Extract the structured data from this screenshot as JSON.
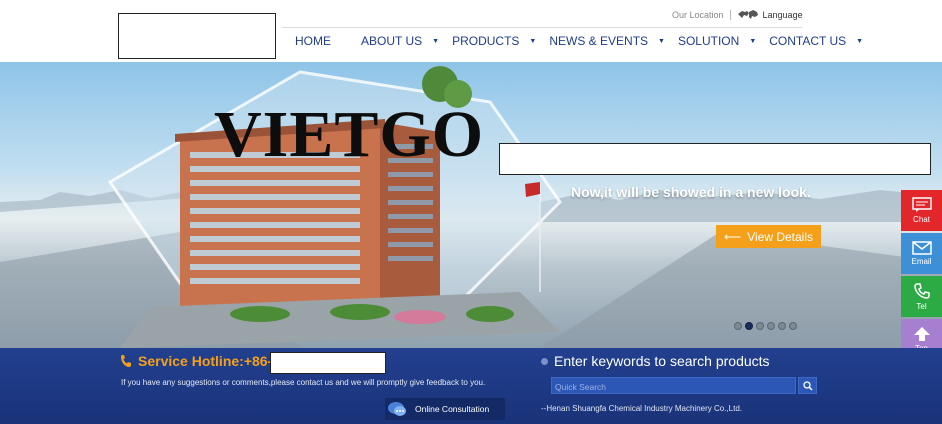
{
  "header": {
    "location_link": "Our Location",
    "language_link": "Language",
    "nav": [
      {
        "label": "HOME",
        "has_dropdown": false
      },
      {
        "label": "ABOUT US",
        "has_dropdown": true
      },
      {
        "label": "PRODUCTS",
        "has_dropdown": true
      },
      {
        "label": "NEWS & EVENTS",
        "has_dropdown": true
      },
      {
        "label": "SOLUTION",
        "has_dropdown": true
      },
      {
        "label": "CONTACT US",
        "has_dropdown": true
      }
    ]
  },
  "banner": {
    "watermark": "VIETGO",
    "tagline": "Now,it will be showed in a new look.",
    "cta_label": "View Details",
    "slide_count": 6,
    "active_slide": 2
  },
  "side_widget": {
    "chat": "Chat",
    "email": "Email",
    "tel": "Tel",
    "top": "Top"
  },
  "footer": {
    "hotline": "Service Hotline:+86-",
    "suggestion": "If you have any suggestions or comments,please contact us and we will promptly give feedback to you.",
    "consult_label": "Online Consultation",
    "search_heading": "Enter keywords to search products",
    "search_placeholder": "Quick Search",
    "company": "--Henan Shuangfa Chemical Industry Machinery Co.,Ltd."
  },
  "colors": {
    "nav_text": "#1f3d8c",
    "accent_orange": "#f5a01a",
    "footer_bg": "#22408f",
    "chat": "#e3262a",
    "email": "#3d8fd6",
    "tel": "#2cab45",
    "top": "#a77fd1"
  }
}
